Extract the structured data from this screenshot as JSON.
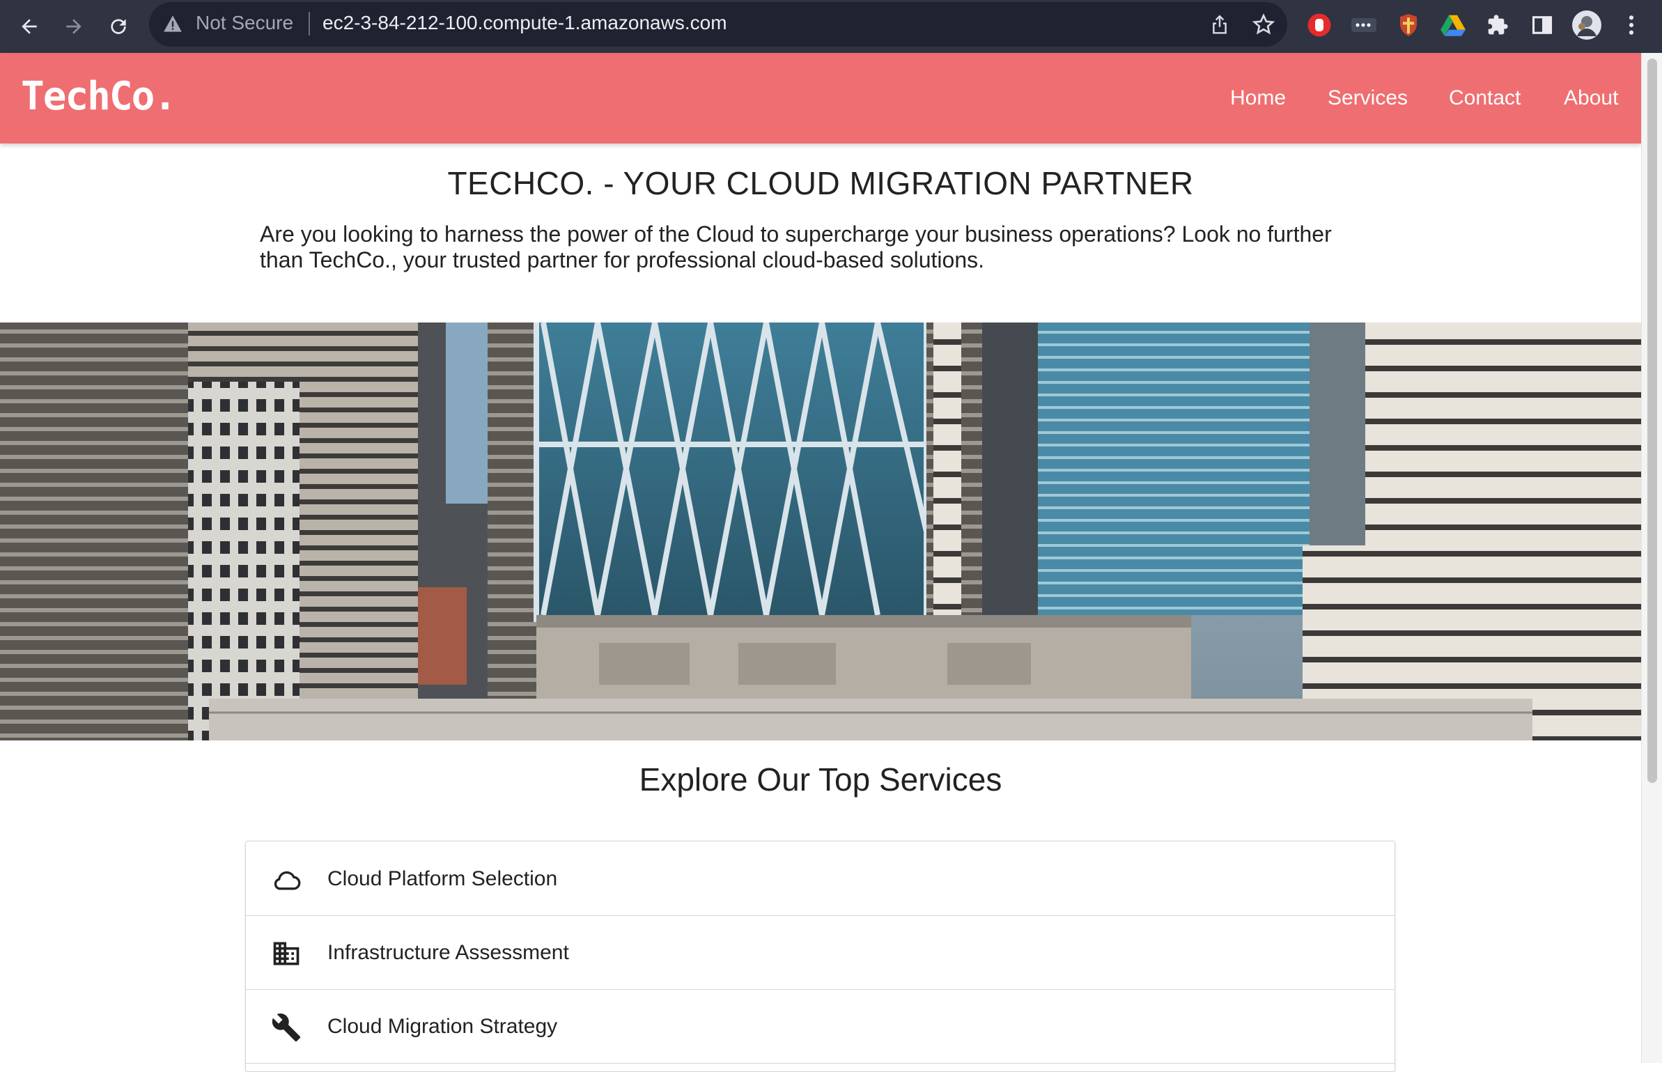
{
  "browser": {
    "security_label": "Not Secure",
    "url": "ec2-3-84-212-100.compute-1.amazonaws.com",
    "toolbar_icons": [
      "back-icon",
      "forward-icon",
      "reload-icon",
      "share-icon",
      "star-icon",
      "stop-hand-icon",
      "more-dots-icon",
      "shield-extension-icon",
      "drive-icon",
      "puzzle-icon",
      "sidepanel-icon",
      "avatar",
      "menu-icon"
    ]
  },
  "site": {
    "logo": "TechCo.",
    "nav": [
      "Home",
      "Services",
      "Contact",
      "About"
    ],
    "accent_color": "#ef6e71"
  },
  "hero": {
    "title": "TECHCO. - YOUR CLOUD MIGRATION PARTNER",
    "description": "Are you looking to harness the power of the Cloud to supercharge your business operations? Look no further than TechCo., your trusted partner for professional cloud-based solutions."
  },
  "services": {
    "heading": "Explore Our Top Services",
    "items": [
      {
        "label": "Cloud Platform Selection",
        "icon": "cloud-icon"
      },
      {
        "label": "Infrastructure Assessment",
        "icon": "building-icon"
      },
      {
        "label": "Cloud Migration Strategy",
        "icon": "wrench-icon"
      }
    ]
  }
}
